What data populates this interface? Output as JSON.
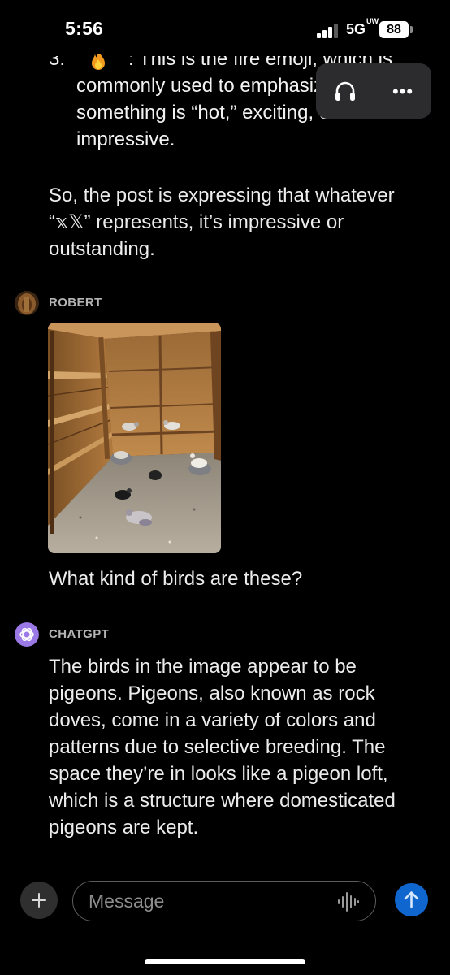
{
  "status_bar": {
    "time": "5:56",
    "network": "5G",
    "network_sup": "UW",
    "battery": "88"
  },
  "pill_menu": {
    "more_label": "•••"
  },
  "assistant_prev": {
    "list_number": "3.",
    "list_first_line": ": This is the fire emoji, which is",
    "list_line2": "commonly used to emphasize that",
    "list_line3": "something is “hot,” exciting, or",
    "list_line4": "impressive.",
    "summary": "So, the post is expressing that whatever “𝕩𝕏” represents, it’s impressive or outstanding."
  },
  "user_message": {
    "sender": "ROBERT",
    "question": "What kind of birds are these?"
  },
  "assistant_reply": {
    "sender": "CHATGPT",
    "text": "The birds in the image appear to be pigeons. Pigeons, also known as rock doves, come in a variety of colors and patterns due to selective breeding. The space they’re in looks like a pigeon loft, which is a structure where domesticated pigeons are kept."
  },
  "composer": {
    "placeholder": "Message"
  },
  "colors": {
    "background": "#000000",
    "send_button": "#0f66cf",
    "chatgpt_avatar": "#9a78e6",
    "pill": "#2c2c2e"
  },
  "icons": [
    "signal-icon",
    "battery-icon",
    "headphones-icon",
    "more-icon",
    "fire-emoji-icon",
    "chatgpt-logo-icon",
    "plus-icon",
    "voice-wave-icon",
    "send-arrow-icon"
  ]
}
